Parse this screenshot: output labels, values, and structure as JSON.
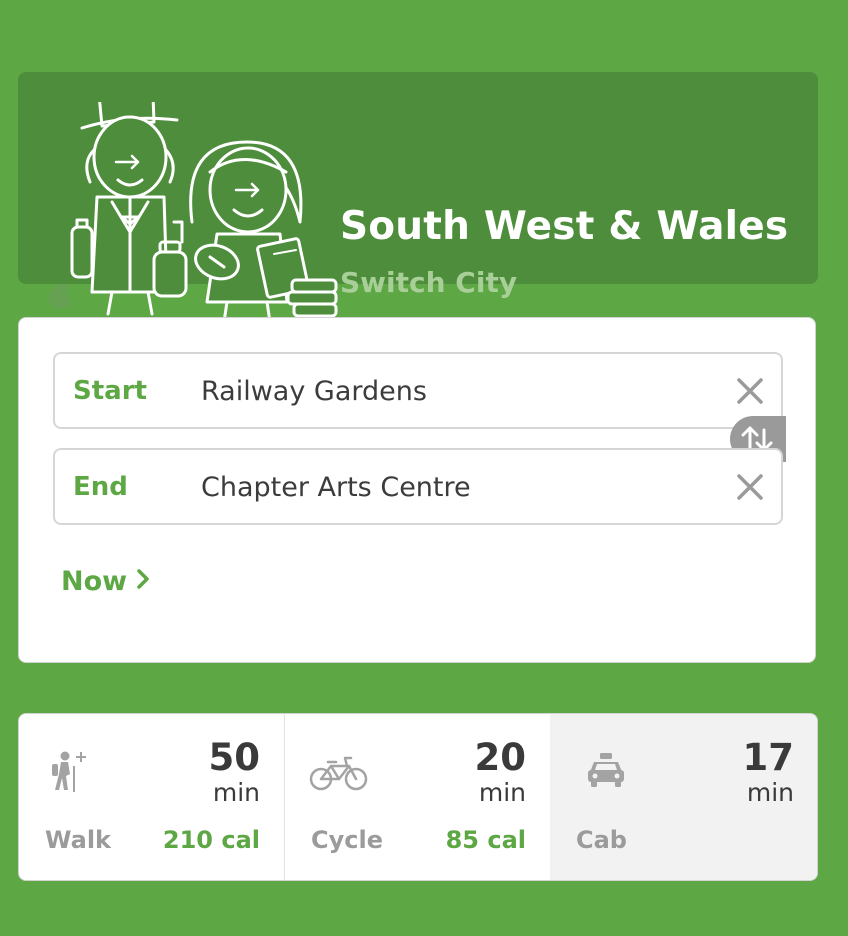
{
  "header": {
    "title": "South West & Wales",
    "subtitle": "Switch City",
    "illustration": "mascots-illustration"
  },
  "route": {
    "start_label": "Start",
    "start_value": "Railway Gardens",
    "end_label": "End",
    "end_value": "Chapter Arts Centre",
    "time_label": "Now",
    "swap_icon": "swap-arrows-icon",
    "clear_icon": "close-icon"
  },
  "modes": [
    {
      "name": "Walk",
      "time": "50",
      "unit": "min",
      "calories": "210 cal",
      "icon": "hiker-icon"
    },
    {
      "name": "Cycle",
      "time": "20",
      "unit": "min",
      "calories": "85 cal",
      "icon": "bicycle-icon"
    },
    {
      "name": "Cab",
      "time": "17",
      "unit": "min",
      "calories": "",
      "icon": "taxi-icon"
    }
  ],
  "colors": {
    "background": "#5da744",
    "banner": "#4e8d3c",
    "accent": "#5da744",
    "swap_button": "#9a9a9a",
    "cab_tile": "#f2f2f2"
  }
}
